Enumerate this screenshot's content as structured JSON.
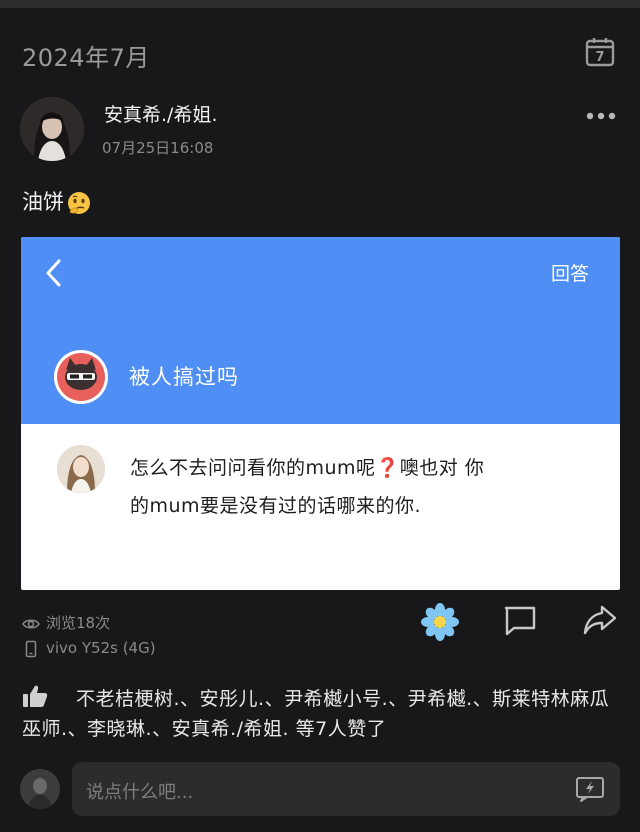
{
  "header": {
    "date": "2024年7月",
    "calendar_day": "7"
  },
  "post": {
    "username": "安真希./希姐.",
    "timestamp": "07月25日16:08",
    "text": "油饼"
  },
  "embedded_screenshot": {
    "answer_label": "回答",
    "question": "被人搞过吗",
    "answer_line1": "怎么不去问问看你的mum呢❓噢也对 你",
    "answer_line2": "的mum要是没有过的话哪来的你."
  },
  "stats": {
    "views": "浏览18次",
    "device": "vivo Y52s (4G)"
  },
  "likes": {
    "text": "不老桔梗树.、安彤儿.、尹希樾小号.、尹希樾.、斯莱特林麻瓜巫师.、李晓琳.、安真希./希姐. 等7人赞了"
  },
  "comment": {
    "placeholder": "说点什么吧..."
  },
  "colors": {
    "background": "#18181a",
    "accent_blue": "#4f8ef4",
    "input_bg": "#2c2c2e",
    "muted_text": "#8a8a8c"
  },
  "icons": [
    "calendar-icon",
    "more-icon",
    "back-icon",
    "eye-icon",
    "phone-icon",
    "flower-icon",
    "comment-icon",
    "share-icon",
    "thumbs-up-icon",
    "flash-icon"
  ]
}
